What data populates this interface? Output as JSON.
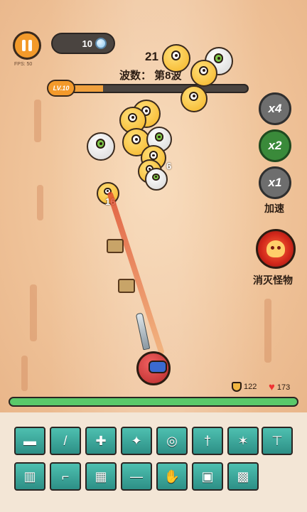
{
  "hud": {
    "pause_icon": "pause-icon",
    "fps_text": "FPS: 50",
    "gem_count": "10",
    "gem_icon": "gem-icon",
    "wave_text": "波数：  第8波",
    "level_label": "LV.10",
    "level_progress": 0.22
  },
  "speed_buttons": {
    "x4": "x4",
    "x2": "x2",
    "x1": "x1",
    "label": "加速"
  },
  "skill": {
    "label": "消灭怪物",
    "icon": "monster-icon"
  },
  "damage_numbers": [
    "21",
    "6",
    "16"
  ],
  "stats": {
    "shield_value": "122",
    "heart_value": "173",
    "shield_icon": "shield-icon",
    "heart_icon": "heart-icon"
  },
  "player_hp_fraction": 1.0,
  "inventory": [
    {
      "name": "pistol-icon",
      "glyph": "▬"
    },
    {
      "name": "dagger-icon",
      "glyph": "/"
    },
    {
      "name": "medkit-icon",
      "glyph": "✚"
    },
    {
      "name": "shuriken-icon",
      "glyph": "✦"
    },
    {
      "name": "bracelet-icon",
      "glyph": "◎"
    },
    {
      "name": "sword-icon",
      "glyph": "†"
    },
    {
      "name": "star-blade-icon",
      "glyph": "✶"
    },
    {
      "name": "hammer-icon",
      "glyph": "⊤"
    },
    {
      "name": "gauntlet-icon",
      "glyph": "▥"
    },
    {
      "name": "revolver-icon",
      "glyph": "⌐"
    },
    {
      "name": "box-icon",
      "glyph": "▦"
    },
    {
      "name": "knife-icon",
      "glyph": "—"
    },
    {
      "name": "glove-icon",
      "glyph": "✋"
    },
    {
      "name": "chest-icon",
      "glyph": "▣"
    },
    {
      "name": "crate-icon",
      "glyph": "▩"
    }
  ],
  "colors": {
    "accent": "#f39a2b",
    "hp_green": "#5ac96a",
    "slot_teal": "#3aa89c"
  }
}
